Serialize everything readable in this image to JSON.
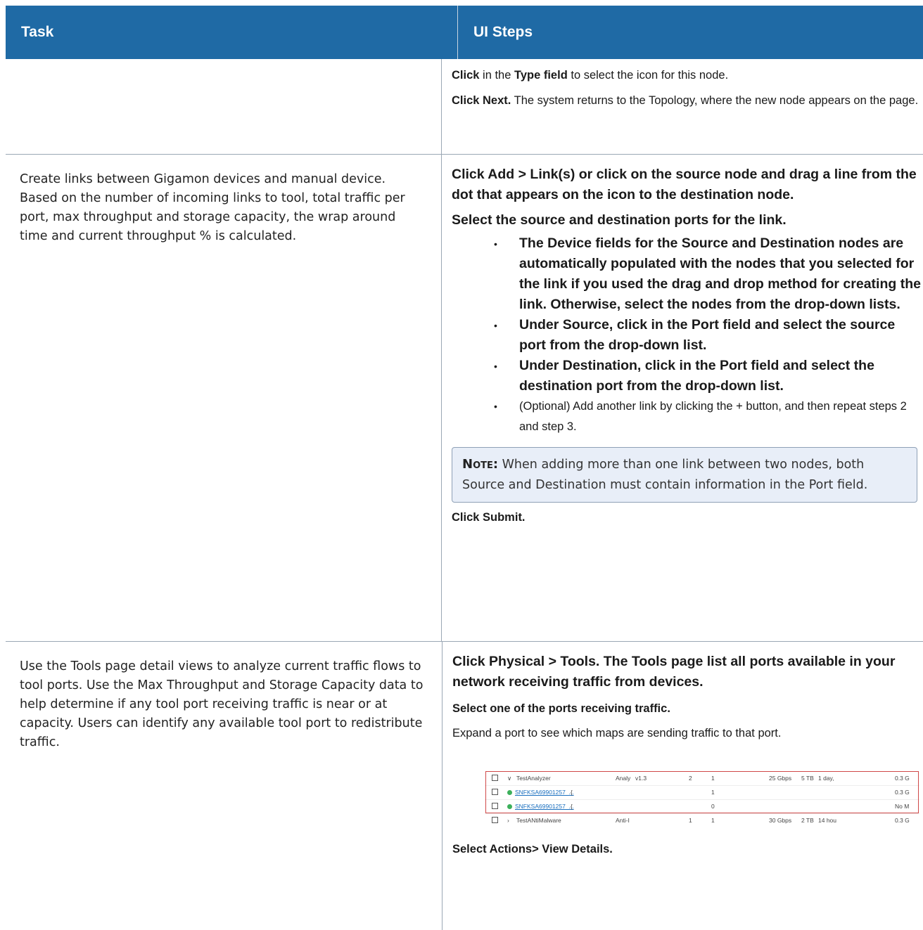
{
  "header": {
    "task": "Task",
    "ui_steps": "UI Steps"
  },
  "row1": {
    "task": "",
    "steps": [
      {
        "b": "Click",
        "t1": " in the ",
        "b2": "Type field",
        "t2": " to select the icon for this node."
      },
      {
        "b": "Click Next.",
        "t": " The system returns to the Topology, where the new node appears on the page."
      }
    ]
  },
  "row2": {
    "task": "Create links between Gigamon devices and manual device. Based on the number of incoming links to tool, total traffic per port, max throughput and storage capacity, the wrap around time and current throughput % is calculated.",
    "step1": "Click Add > Link(s) or click on the source node and drag a line from the dot that appears on the icon to the destination node.",
    "step2": "Select the source and destination ports for the link.",
    "bullets": [
      "The Device fields for the Source and Destination nodes are automatically populated with the nodes that you selected for the link if you used the drag and drop method for creating the link. Otherwise, select the nodes from the drop-down lists.",
      "Under Source, click in the Port field and select the source port from the drop-down list.",
      "Under Destination, click in the Port field and select the destination port from the drop-down list.",
      "(Optional) Add another link by clicking the + button, and then repeat steps 2 and step 3."
    ],
    "bullet_char": "•",
    "note_label": "Note:",
    "note_text": " When adding more than one link between two nodes, both Source and Destination must contain information in the Port field.",
    "submit": "Click Submit."
  },
  "row3": {
    "task": "Use the Tools page detail views to analyze current traffic flows to tool ports. Use the Max Throughput and Storage Capacity data to help determine if any tool port receiving traffic is near or at capacity. Users can identify any available tool port to redistribute traffic.",
    "step1": "Click Physical > Tools. The Tools page list all ports available in your network receiving traffic from devices.",
    "step2": "Select one of the ports receiving traffic.",
    "step3": "Expand a port to see which maps are sending traffic to that port.",
    "step3_end": ".",
    "table_rows": [
      {
        "chev": "∨",
        "name": "TestAnalyzer",
        "type": "Analy",
        "ver": "v1.3",
        "c1": "2",
        "c2": "1",
        "tp": "25 Gbps",
        "cap": "5 TB",
        "time": "1 day,",
        "cur": "0.3 G"
      },
      {
        "link": "SNFKSA69901257_...",
        "extra": "{",
        "c2": "1",
        "cur": "0.3 G"
      },
      {
        "link": "SNFKSA69901257_...",
        "extra": "{",
        "c2": "0",
        "cur": "No M"
      },
      {
        "chev": "›",
        "name": "TestANtiMalware",
        "type": "Anti-I",
        "c1": "1",
        "c2": "1",
        "tp": "30 Gbps",
        "cap": "2 TB",
        "time": "14 hou",
        "cur": "0.3 G"
      }
    ],
    "step4": "Select Actions> View Details."
  },
  "colors": {
    "header_bg": "#1f6aa5",
    "note_bg": "#e8eef8",
    "highlight_border": "#d04848",
    "status_green": "#3cb05b"
  }
}
